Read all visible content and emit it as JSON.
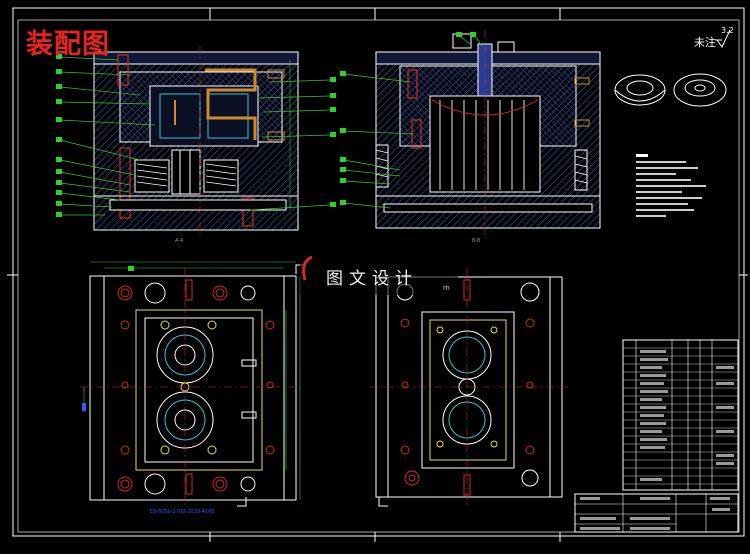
{
  "drawing": {
    "title": "装配图",
    "roughness_label": "未注",
    "roughness_value": "3.2",
    "watermark": "图文设计",
    "watermark_sub": "m",
    "dimension_note": "ES-8050-2700-2010-4100",
    "section_label_left": "A-A",
    "section_label_right": "B-B"
  },
  "colors": {
    "background": "#000000",
    "outline": "#ffffff",
    "leader": "#31c931",
    "hatch": "#3b6bd6",
    "cooling": "#d08a2a",
    "dimension": "#2fc92f",
    "title_red": "#e8241f",
    "bolt_red": "#d22a2a",
    "cyan": "#36c6d0",
    "blue_dim": "#3a55ff"
  }
}
